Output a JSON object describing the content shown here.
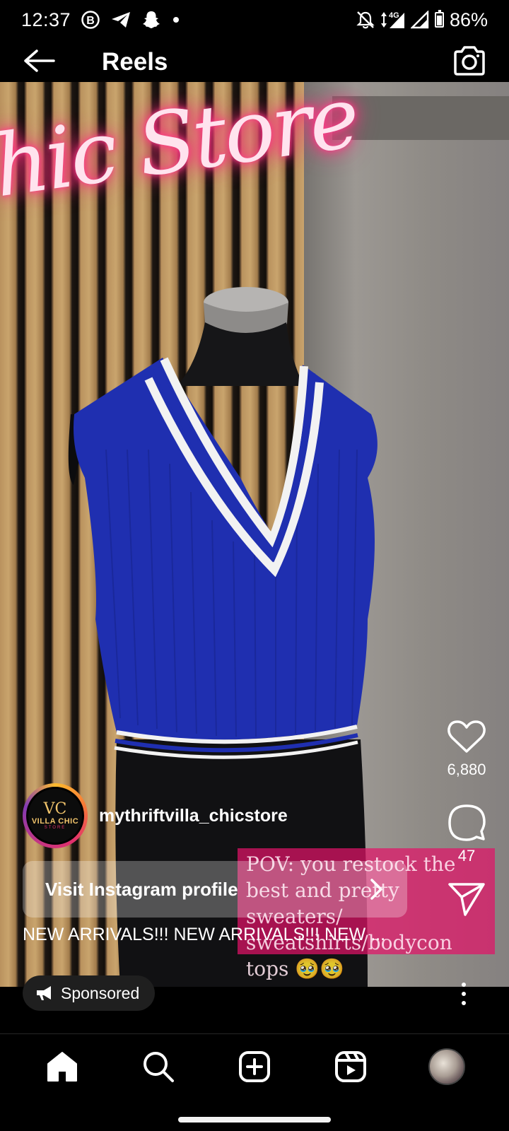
{
  "status_bar": {
    "time": "12:37",
    "network": "4G",
    "battery_percent": "86%",
    "battery_level": 0.86,
    "icons": [
      "b-circle-icon",
      "telegram-icon",
      "snapchat-icon",
      "notification-dot-icon",
      "mute-bell-icon",
      "data-arrows-icon",
      "signal-icon",
      "signal-icon-2",
      "battery-icon"
    ]
  },
  "header": {
    "title": "Reels",
    "back_icon": "arrow-left-icon",
    "camera_icon": "camera-icon"
  },
  "reel": {
    "neon_sign": "hic Store",
    "actions": {
      "likes": "6,880",
      "comments": "47"
    },
    "sticker_text": "POV: you restock the best and pretty sweaters/ sweatshirts/bodycon tops 🥹🥹",
    "account": {
      "username": "mythriftvilla_chicstore",
      "logo_mark": "VC",
      "logo_text": "VILLA CHIC",
      "logo_sub": "STORE"
    },
    "visit_button": "Visit Instagram profile",
    "caption": "NEW ARRIVALS!!! NEW ARRIVALS!!! NEW ..."
  },
  "footer": {
    "sponsored_label": "Sponsored",
    "nav": [
      "home-icon",
      "search-icon",
      "create-icon",
      "reels-icon",
      "profile-avatar"
    ]
  },
  "colors": {
    "background": "#000000",
    "sticker_pink": "#e21468",
    "vest_blue": "#1f2fb0"
  }
}
